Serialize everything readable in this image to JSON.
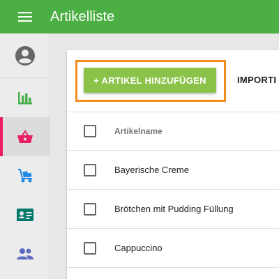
{
  "app": {
    "title": "Artikelliste",
    "accent_color": "#4caf43"
  },
  "sidebar": {
    "items": [
      {
        "icon": "account-circle-icon",
        "color": "#616161"
      },
      {
        "icon": "bar-chart-icon",
        "color": "#4caf50"
      },
      {
        "icon": "shopping-basket-icon",
        "color": "#e91e63",
        "active": true
      },
      {
        "icon": "hand-truck-icon",
        "color": "#1e88e5"
      },
      {
        "icon": "contact-card-icon",
        "color": "#00796b"
      },
      {
        "icon": "people-icon",
        "color": "#5c6bc0"
      }
    ]
  },
  "toolbar": {
    "add_label": "+ Artikel hinzufügen",
    "import_label": "Importi"
  },
  "table": {
    "column_header": "Artikelname",
    "rows": [
      {
        "name": "Bayerische Creme"
      },
      {
        "name": "Brötchen mit Pudding Füllung"
      },
      {
        "name": "Cappuccino"
      }
    ]
  }
}
